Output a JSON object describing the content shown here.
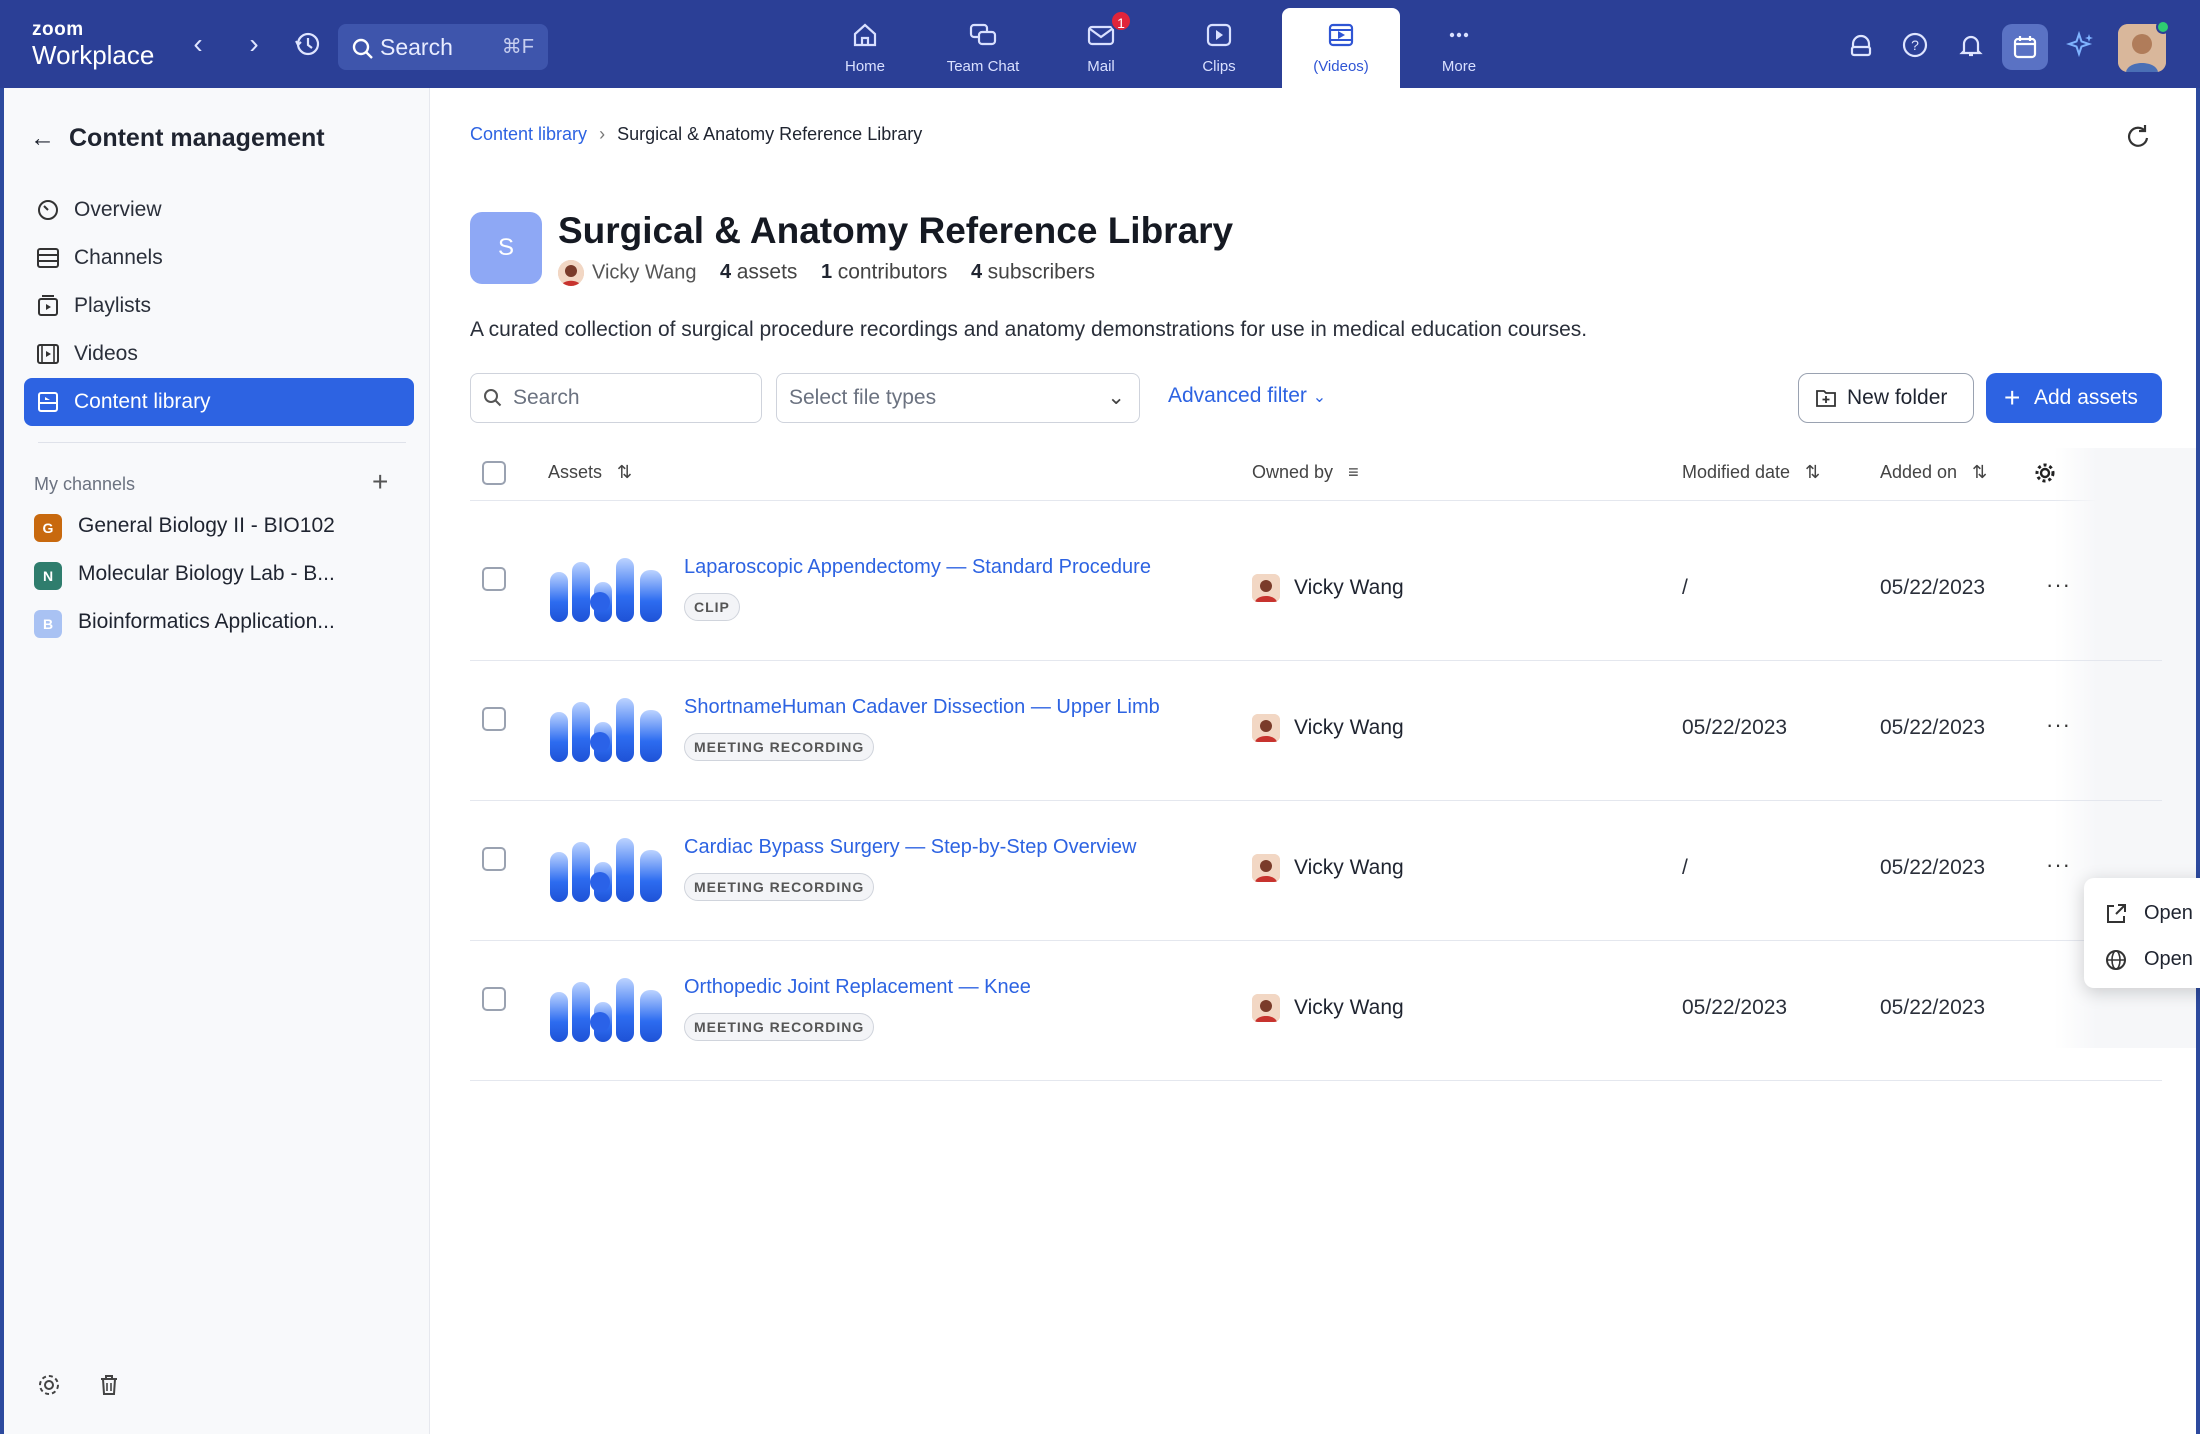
{
  "app": {
    "brand_small": "zoom",
    "brand_large": "Workplace"
  },
  "topbar": {
    "search_label": "Search",
    "search_shortcut": "⌘F",
    "tabs": [
      {
        "label": "Home",
        "icon": "home-icon"
      },
      {
        "label": "Team Chat",
        "icon": "chat-icon"
      },
      {
        "label": "Mail",
        "icon": "mail-icon",
        "badge": "1"
      },
      {
        "label": "Clips",
        "icon": "clips-icon"
      },
      {
        "label": "(Videos)",
        "icon": "videos-icon",
        "active": true
      },
      {
        "label": "More",
        "icon": "more-icon"
      }
    ]
  },
  "sidebar": {
    "title": "Content management",
    "items": [
      {
        "label": "Overview",
        "icon": "gauge-icon"
      },
      {
        "label": "Channels",
        "icon": "channels-icon"
      },
      {
        "label": "Playlists",
        "icon": "playlist-icon"
      },
      {
        "label": "Videos",
        "icon": "video-icon"
      },
      {
        "label": "Content library",
        "icon": "library-icon",
        "active": true
      }
    ],
    "my_channels_label": "My channels",
    "channels": [
      {
        "letter": "G",
        "name": "General Biology II - BIO102",
        "color": "#c8690e"
      },
      {
        "letter": "N",
        "name": "Molecular Biology Lab - B...",
        "color": "#2f7d6d"
      },
      {
        "letter": "B",
        "name": "Bioinformatics Application...",
        "color": "#a9c2f3"
      }
    ]
  },
  "main": {
    "breadcrumb_root": "Content library",
    "breadcrumb_current": "Surgical & Anatomy Reference Library",
    "library_initial": "S",
    "library_title": "Surgical & Anatomy Reference Library",
    "owner": "Vicky Wang",
    "assets_count": "4",
    "assets_label": "assets",
    "contributors_count": "1",
    "contributors_label": "contributors",
    "subscribers_count": "4",
    "subscribers_label": "subscribers",
    "description": "A curated collection of surgical procedure recordings and anatomy demonstrations for use in medical education courses.",
    "search_placeholder": "Search",
    "file_types_placeholder": "Select file types",
    "advanced_filter": "Advanced filter",
    "new_folder": "New folder",
    "add_assets": "Add assets"
  },
  "table": {
    "headers": {
      "assets": "Assets",
      "owned_by": "Owned by",
      "modified": "Modified date",
      "added": "Added on"
    },
    "rows": [
      {
        "name": "Laparoscopic Appendectomy — Standard Procedure",
        "tag": "CLIP",
        "owner": "Vicky Wang",
        "modified": "/",
        "added": "05/22/2023"
      },
      {
        "name": "ShortnameHuman Cadaver Dissection — Upper Limb",
        "tag": "MEETING RECORDING",
        "owner": "Vicky Wang",
        "modified": "05/22/2023",
        "added": "05/22/2023"
      },
      {
        "name": "Cardiac Bypass Surgery — Step-by-Step Overview",
        "tag": "MEETING RECORDING",
        "owner": "Vicky Wang",
        "modified": "/",
        "added": "05/22/2023"
      },
      {
        "name": "Orthopedic Joint Replacement — Knee",
        "tag": "MEETING RECORDING",
        "owner": "Vicky Wang",
        "modified": "05/22/2023",
        "added": "05/22/2023"
      }
    ],
    "more_label": "···"
  },
  "context_menu": {
    "items": [
      {
        "label": "Open",
        "icon": "external-link-icon"
      },
      {
        "label": "Open",
        "icon": "globe-icon"
      }
    ]
  },
  "colors": {
    "accent": "#2d63e2",
    "topbar": "#2b3f96"
  }
}
